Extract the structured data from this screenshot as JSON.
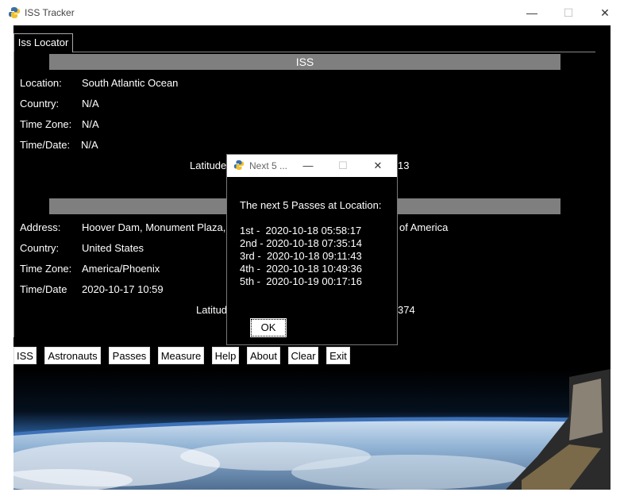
{
  "window": {
    "title": "ISS Tracker",
    "min": "—",
    "max": "☐",
    "close": "✕"
  },
  "tab": {
    "label": "Iss Locator"
  },
  "iss_section": {
    "header": "ISS",
    "location_label": "Location:",
    "location_value": "South Atlantic Ocean",
    "country_label": "Country:",
    "country_value": "N/A",
    "timezone_label": "Time Zone:",
    "timezone_value": "N/A",
    "timedate_label": "Time/Date:",
    "timedate_value": "N/A",
    "latlon_left": "Latitude",
    "latlon_right": "13"
  },
  "user_section": {
    "header": "",
    "address_label": "Address:",
    "address_left": "Hoover Dam, Monument Plaza,",
    "address_right": "of America",
    "country_label": "Country:",
    "country_value": "United States",
    "timezone_label": "Time Zone:",
    "timezone_value": "America/Phoenix",
    "timedate_label": "Time/Date",
    "timedate_value": "2020-10-17 10:59",
    "latlon_left": "Latitude",
    "latlon_right": "374"
  },
  "buttons": [
    "ISS",
    "Astronauts",
    "Passes",
    "Measure",
    "Help",
    "About",
    "Clear",
    "Exit"
  ],
  "dialog": {
    "title": "Next 5 ...",
    "heading": "The next 5 Passes at Location:",
    "passes": [
      "1st -  2020-10-18 05:58:17",
      "2nd - 2020-10-18 07:35:14",
      "3rd -  2020-10-18 09:11:43",
      "4th -  2020-10-18 10:49:36",
      "5th -  2020-10-19 00:17:16"
    ],
    "ok": "OK"
  },
  "colors": {
    "bar": "#7f7f7f",
    "background": "#000000",
    "text": "#ffffff"
  }
}
